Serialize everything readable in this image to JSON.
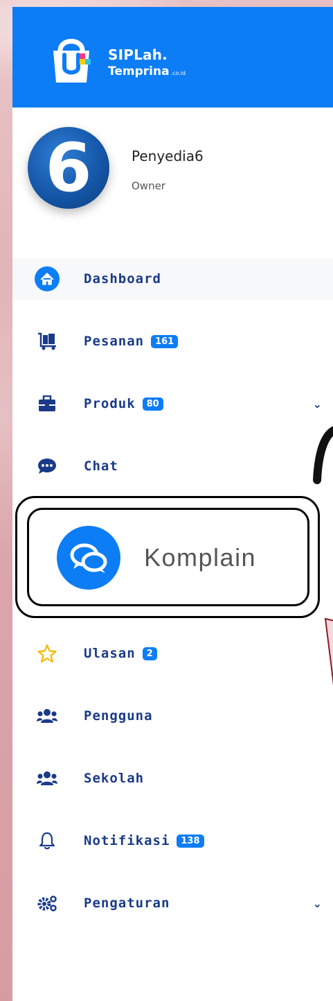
{
  "brand": {
    "name_line1": "SIPLah.",
    "name_line2": "Temprina",
    "tld": ".co.id"
  },
  "profile": {
    "avatar_text": "6",
    "name": "Penyedia6",
    "role": "Owner"
  },
  "nav": {
    "dashboard": {
      "label": "Dashboard",
      "icon": "home-icon"
    },
    "pesanan": {
      "label": "Pesanan",
      "badge": "161",
      "icon": "cart-icon"
    },
    "produk": {
      "label": "Produk",
      "badge": "80",
      "icon": "briefcase-icon"
    },
    "chat": {
      "label": "Chat",
      "icon": "chat-bubble-icon"
    },
    "komplain": {
      "label": "Komplain",
      "icon": "chat-bubbles-icon"
    },
    "ulasan": {
      "label": "Ulasan",
      "badge": "2",
      "icon": "star-icon"
    },
    "pengguna": {
      "label": "Pengguna",
      "icon": "users-icon"
    },
    "sekolah": {
      "label": "Sekolah",
      "icon": "users-icon"
    },
    "notifikasi": {
      "label": "Notifikasi",
      "badge": "138",
      "icon": "bell-icon"
    },
    "pengaturan": {
      "label": "Pengaturan",
      "icon": "cogs-icon"
    }
  },
  "colors": {
    "header": "#0d7df5",
    "nav_text": "#1a3a8a",
    "badge": "#0d7df5",
    "star": "#f5b800"
  }
}
